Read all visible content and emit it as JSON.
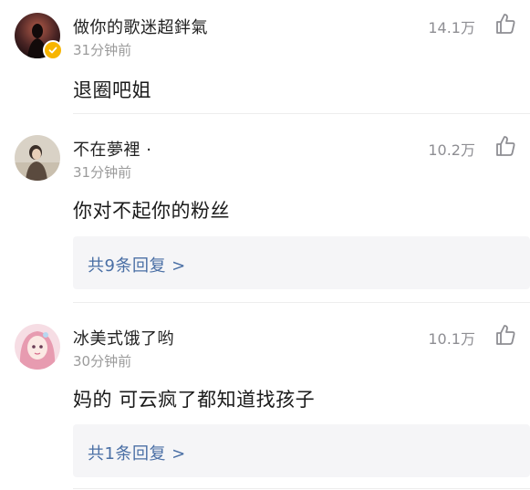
{
  "comments": [
    {
      "username": "做你的歌迷超鉡氣",
      "time": "31分钟前",
      "likes": "14.1万",
      "text": "退圈吧姐",
      "verified": true,
      "avatar_icon": "dark-silhouette-avatar"
    },
    {
      "username": "不在夢裡 ·",
      "time": "31分钟前",
      "likes": "10.2万",
      "text": "你对不起你的粉丝",
      "reply_label": "共9条回复 >",
      "avatar_icon": "person-portrait-avatar"
    },
    {
      "username": "冰美式饿了哟",
      "time": "30分钟前",
      "likes": "10.1万",
      "text": "妈的 可云疯了都知道找孩子",
      "reply_label": "共1条回复 >",
      "avatar_icon": "pink-anime-girl-avatar"
    }
  ],
  "colors": {
    "link": "#4a6fa5",
    "muted": "#9b9b9b",
    "reply_bg": "#f5f5f7",
    "verified": "#f7b500"
  },
  "icons": [
    "like-thumb-icon",
    "verified-badge-icon"
  ]
}
